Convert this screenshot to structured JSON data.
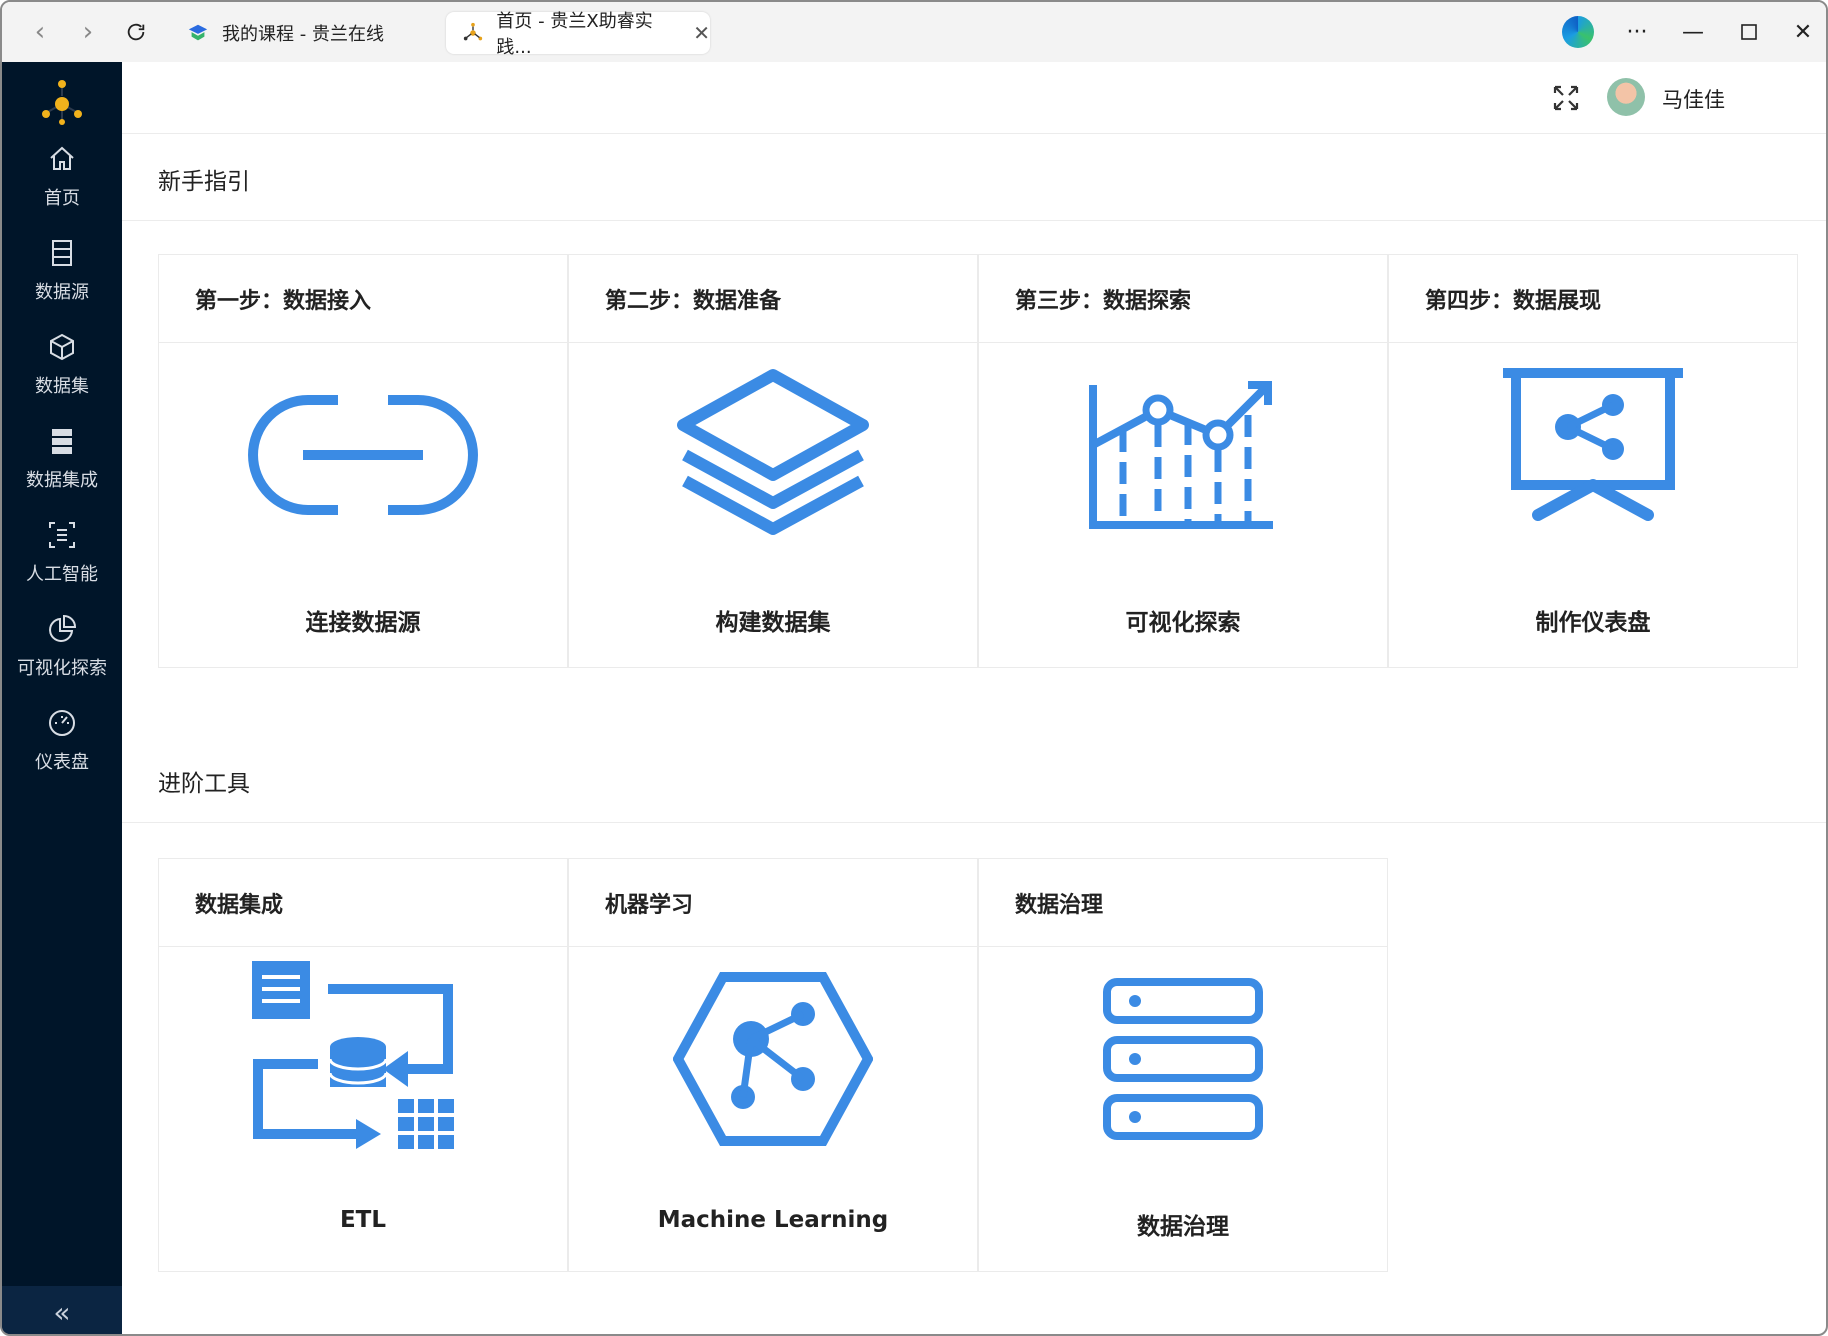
{
  "browser": {
    "tabs": [
      {
        "title": "我的课程 - 贵兰在线"
      },
      {
        "title": "首页 - 贵兰X助睿实践...",
        "active": true
      }
    ]
  },
  "sidebar": {
    "items": [
      {
        "label": "首页",
        "icon": "home-icon"
      },
      {
        "label": "数据源",
        "icon": "datasource-icon"
      },
      {
        "label": "数据集",
        "icon": "cube-icon"
      },
      {
        "label": "数据集成",
        "icon": "database-icon"
      },
      {
        "label": "人工智能",
        "icon": "ai-icon"
      },
      {
        "label": "可视化探索",
        "icon": "pie-icon"
      },
      {
        "label": "仪表盘",
        "icon": "dashboard-icon"
      }
    ],
    "collapse": "«"
  },
  "header": {
    "user_name": "马佳佳"
  },
  "guide": {
    "title": "新手指引",
    "cards": [
      {
        "step": "第一步：数据接入",
        "label": "连接数据源",
        "icon": "link-icon"
      },
      {
        "step": "第二步：数据准备",
        "label": "构建数据集",
        "icon": "layers-icon"
      },
      {
        "step": "第三步：数据探索",
        "label": "可视化探索",
        "icon": "chart-icon"
      },
      {
        "step": "第四步：数据展现",
        "label": "制作仪表盘",
        "icon": "presentation-icon"
      }
    ]
  },
  "tools": {
    "title": "进阶工具",
    "cards": [
      {
        "title": "数据集成",
        "label": "ETL",
        "icon": "etl-icon"
      },
      {
        "title": "机器学习",
        "label": "Machine Learning",
        "icon": "ml-icon"
      },
      {
        "title": "数据治理",
        "label": "数据治理",
        "icon": "server-icon"
      }
    ]
  },
  "colors": {
    "accent": "#3b8be4",
    "sidebar": "#001529"
  }
}
